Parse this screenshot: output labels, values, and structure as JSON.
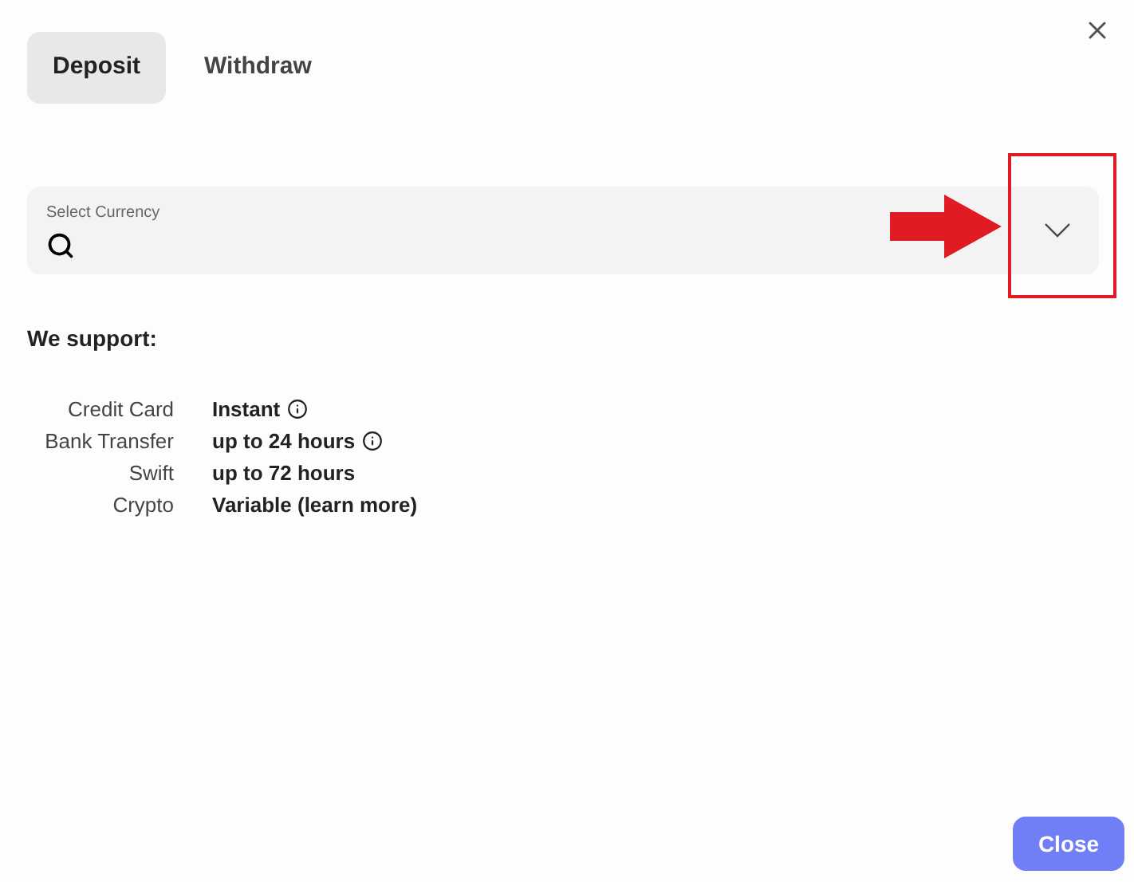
{
  "tabs": [
    {
      "label": "Deposit",
      "selected": true
    },
    {
      "label": "Withdraw",
      "selected": false
    }
  ],
  "currency_field": {
    "label": "Select Currency"
  },
  "annotation": {
    "kind": "arrow-and-frame"
  },
  "support": {
    "heading": "We support:",
    "rows": [
      {
        "label": "Credit Card",
        "value": "Instant",
        "info": true
      },
      {
        "label": "Bank Transfer",
        "value": "up to 24 hours",
        "info": true
      },
      {
        "label": "Swift",
        "value": "up to 72 hours",
        "info": false
      },
      {
        "label": "Crypto",
        "value": "Variable (",
        "link": "learn more",
        "after": ")",
        "info": false
      }
    ]
  },
  "footer": {
    "button": "Close"
  }
}
